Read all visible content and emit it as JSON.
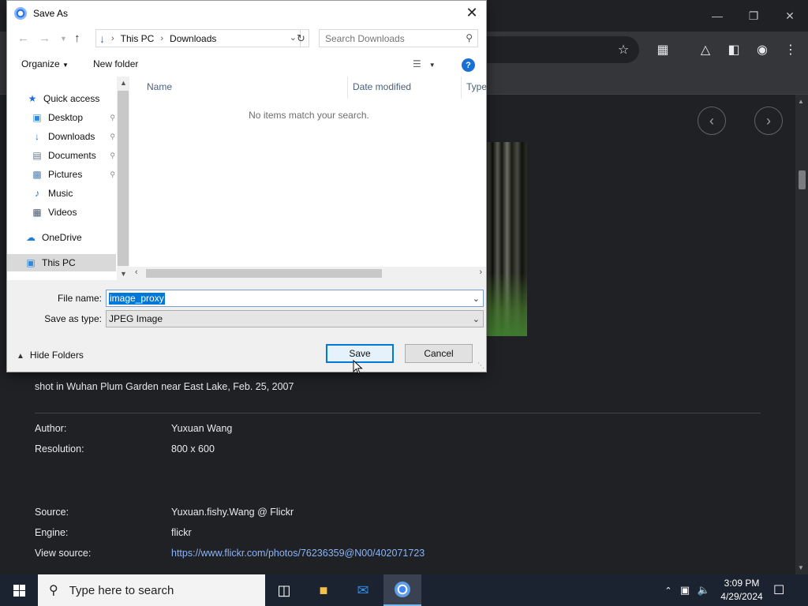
{
  "dialog": {
    "title": "Save As",
    "breadcrumb": [
      "This PC",
      "Downloads"
    ],
    "search_placeholder": "Search Downloads",
    "organize_label": "Organize",
    "new_folder_label": "New folder",
    "help_label": "?",
    "nav_items": [
      {
        "label": "Quick access",
        "icon": "star-icon"
      },
      {
        "label": "Desktop",
        "icon": "desktop-icon",
        "pinned": true
      },
      {
        "label": "Downloads",
        "icon": "download-icon",
        "pinned": true
      },
      {
        "label": "Documents",
        "icon": "documents-icon",
        "pinned": true
      },
      {
        "label": "Pictures",
        "icon": "pictures-icon",
        "pinned": true
      },
      {
        "label": "Music",
        "icon": "music-icon"
      },
      {
        "label": "Videos",
        "icon": "videos-icon"
      },
      {
        "label": "OneDrive",
        "icon": "cloud-icon"
      },
      {
        "label": "This PC",
        "icon": "computer-icon",
        "selected": true
      }
    ],
    "columns": [
      "Name",
      "Date modified",
      "Type"
    ],
    "empty_message": "No items match your search.",
    "file_name_label": "File name:",
    "file_name_value": "image_proxy",
    "save_type_label": "Save as type:",
    "save_type_value": "JPEG Image",
    "hide_folders_label": "Hide Folders",
    "save_label": "Save",
    "cancel_label": "Cancel"
  },
  "page": {
    "caption": "shot in Wuhan Plum Garden near East Lake, Feb. 25, 2007",
    "meta": [
      {
        "label": "Author:",
        "value": "Yuxuan Wang"
      },
      {
        "label": "Resolution:",
        "value": "800 x 600"
      },
      {
        "label": "Source:",
        "value": "Yuxuan.fishy.Wang @ Flickr"
      },
      {
        "label": "Engine:",
        "value": "flickr"
      },
      {
        "label": "View source:",
        "value": "https://www.flickr.com/photos/76236359@N00/402071723"
      }
    ]
  },
  "taskbar": {
    "search_placeholder": "Type here to search",
    "time": "3:09 PM",
    "date": "4/29/2024"
  },
  "colors": {
    "accent": "#0078d7",
    "browser_bg": "#202124",
    "link": "#8ab4f8",
    "taskbar": "#1c2330"
  }
}
